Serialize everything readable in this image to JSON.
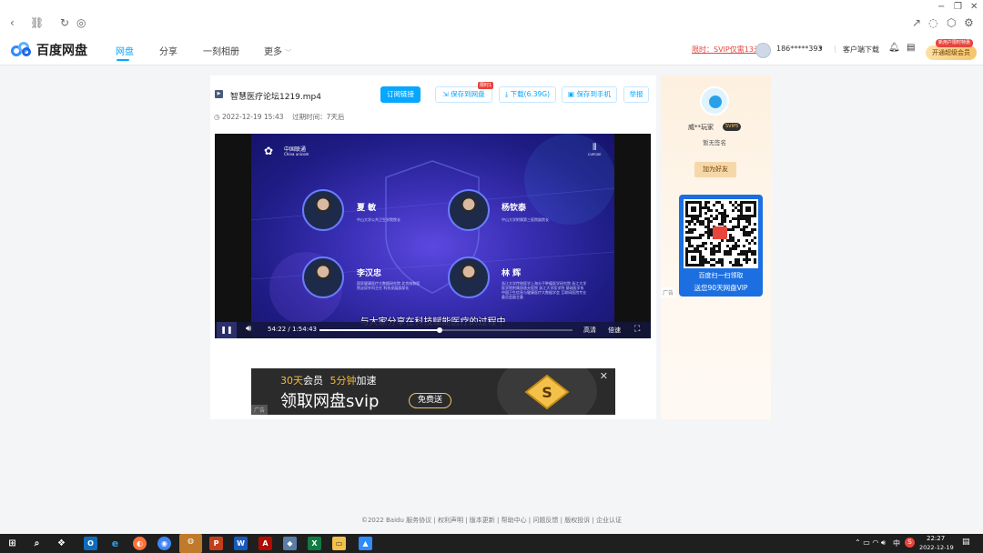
{
  "browser": {
    "icons": [
      "back-icon",
      "link-icon",
      "refresh-icon",
      "globe-icon",
      "share-icon",
      "comment-icon",
      "cube-icon",
      "settings-icon"
    ],
    "window_controls": [
      "−",
      "❐",
      "✕"
    ]
  },
  "header": {
    "logo_text": "百度网盘",
    "nav": [
      "网盘",
      "分享",
      "一刻相册",
      "更多"
    ],
    "promo_link": "限时：SVIP仅需13元",
    "username": "186*****393",
    "client_download": "客户端下载",
    "vip_badge": "新用户限时特惠",
    "vip_button": "开通超级会员"
  },
  "file": {
    "name": "智慧医疗论坛1219.mp4",
    "date": "2022-12-19 15:43",
    "expire": "过期时间：7天后",
    "subscribe_btn": "订阅链接",
    "save_pan_btn": "保存到网盘",
    "save_badge": "限时1",
    "download_btn": "下载(6.39G)",
    "save_phone_btn": "保存到手机",
    "report_btn": "举报"
  },
  "video": {
    "brand": "中国联通",
    "brand_en": "China unicom",
    "corner_logo": "CUPCDE",
    "speakers": [
      {
        "name": "夏 敏",
        "desc": "中山大学公共卫生学院院长"
      },
      {
        "name": "杨钦泰",
        "desc": "中山大学附属第三医院副院长"
      },
      {
        "name": "李汉忠",
        "desc": "国家健康医疗大数据研究院 北京协和医院泌尿外科主任 科技发展部部长"
      },
      {
        "name": "林 辉",
        "desc": "浙江大学传统医学上海分子肿瘤医学研究院 浙江大学医学院附属邵逸夫医院 浙江大学医学院 基础医学系 中国卫生信息与健康医疗大数据学会 互联网医院专业委员会副主委"
      }
    ],
    "subtitle": "与大家分享在科技赋能医疗的过程中",
    "current_time": "54:22",
    "duration": "1:54:43",
    "progress": 0.474,
    "quality": "高清",
    "speed": "倍速"
  },
  "ad": {
    "line1_a": "30天",
    "line1_b": "会员",
    "line1_c": "5分钟",
    "line1_d": "加速",
    "line2": "领取网盘svip",
    "pill": "免费送",
    "tag": "广告"
  },
  "side": {
    "user_name": "威**玩家",
    "svip_badge": "SVIP5",
    "signature": "暂无签名",
    "add_friend": "加为好友",
    "qr_caption1": "百度扫一扫领取",
    "qr_caption2": "送您90天网盘VIP",
    "ad_tag": "广告"
  },
  "footer": {
    "text": "©2022 Baidu  服务协议 | 权利声明 | 版本更新 | 帮助中心 | 问题反馈 | 版权投诉 | 企业认证"
  },
  "taskbar": {
    "tray_text": "中",
    "time": "22:27",
    "date": "2022-12-19"
  },
  "colors": {
    "accent": "#06a7ff",
    "promo": "#e8453c",
    "vip": "#f5b93d"
  }
}
